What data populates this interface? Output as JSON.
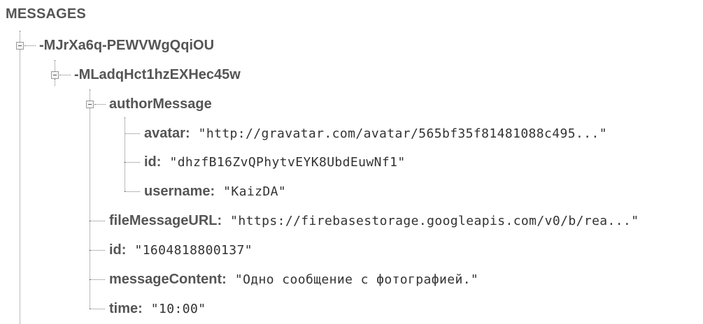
{
  "root": {
    "title": "MESSAGES"
  },
  "nodes": {
    "message_group": {
      "key": "-MJrXa6q-PEWVWgQqiOU"
    },
    "message": {
      "key": "-MLadqHct1hzEXHec45w"
    },
    "author_message": {
      "key": "authorMessage"
    },
    "avatar": {
      "key": "avatar",
      "value": "\"http://gravatar.com/avatar/565bf35f81481088c495...\""
    },
    "author_id": {
      "key": "id",
      "value": "\"dhzfB16ZvQPhytvEYK8UbdEuwNf1\""
    },
    "username": {
      "key": "username",
      "value": "\"KaizDA\""
    },
    "file_message_url": {
      "key": "fileMessageURL",
      "value": "\"https://firebasestorage.googleapis.com/v0/b/rea...\""
    },
    "message_id": {
      "key": "id",
      "value": "\"1604818800137\""
    },
    "message_content": {
      "key": "messageContent",
      "value": "\"Одно сообщение с фотографией.\""
    },
    "time": {
      "key": "time",
      "value": "\"10:00\""
    }
  },
  "colon": ":"
}
